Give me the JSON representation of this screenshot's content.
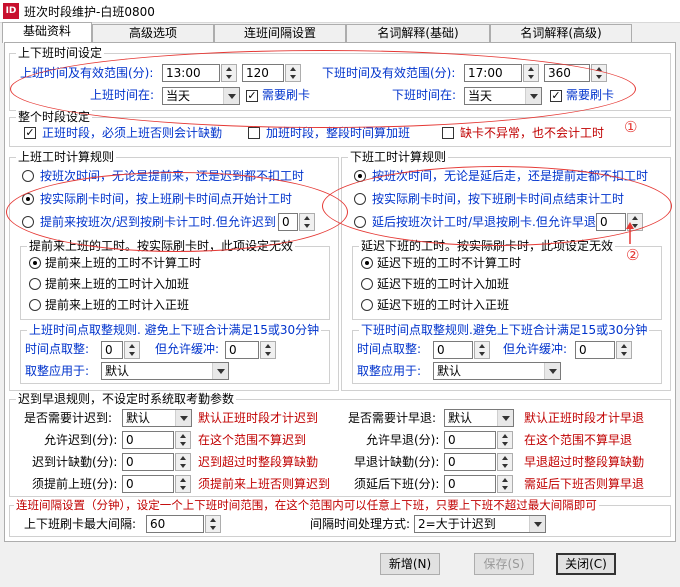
{
  "window": {
    "title": "班次时段维护-白班0800",
    "icon": "app-logo"
  },
  "tabs": [
    {
      "label": "基础资料"
    },
    {
      "label": "高级选项"
    },
    {
      "label": "连班间隔设置"
    },
    {
      "label": "名词解释(基础)"
    },
    {
      "label": "名词解释(高级)"
    }
  ],
  "shift_time": {
    "title": "上下班时间设定",
    "on_duty_label": "上班时间及有效范围(分):",
    "on_duty_time": "13:00",
    "on_duty_range": "120",
    "off_duty_label": "下班时间及有效范围(分):",
    "off_duty_time": "17:00",
    "off_duty_range": "360",
    "on_day_label": "上班时间在:",
    "on_day": "当天",
    "on_need_card": "需要刷卡",
    "off_day_label": "下班时间在:",
    "off_day": "当天",
    "off_need_card": "需要刷卡"
  },
  "whole_period": {
    "title": "整个时段设定",
    "normal": "正班时段，必须上班否则会计缺勤",
    "overtime": "加班时段，整段时间算加班",
    "no_abnormal": "缺卡不异常，也不会计工时"
  },
  "on_rules": {
    "title": "上班工时计算规则",
    "opt1": "按班次时间，无论是提前来，还是迟到都不扣工时",
    "opt2": "按实际刷卡时间，按上班刷卡时间点开始计工时",
    "opt3": "提前来按班次/迟到按刷卡计工时.但允许迟到",
    "allow_late": "0",
    "early_title": "提前来上班的工时。按实际刷卡时，此项设定无效",
    "early1": "提前来上班的工时不计算工时",
    "early2": "提前来上班的工时计入加班",
    "early3": "提前来上班的工时计入正班",
    "round_title": "上班时间点取整规则. 避免上下班合计满足15或30分钟",
    "round_label": "时间点取整:",
    "round_value": "0",
    "buffer_label": "但允许缓冲:",
    "buffer_value": "0",
    "apply_label": "取整应用于:",
    "apply_value": "默认"
  },
  "off_rules": {
    "title": "下班工时计算规则",
    "opt1": "按班次时间，无论是延后走，还是提前走都不扣工时",
    "opt2": "按实际刷卡时间，按下班刷卡时间点结束计工时",
    "opt3": "延后按班次计工时/早退按刷卡.但允许早退",
    "allow_early": "0",
    "late_title": "延迟下班的工时。按实际刷卡时，此项设定无效",
    "late1": "延迟下班的工时不计算工时",
    "late2": "延迟下班的工时计入加班",
    "late3": "延迟下班的工时计入正班",
    "round_title": "下班时间点取整规则.避免上下班合计满足15或30分钟",
    "round_label": "时间点取整:",
    "round_value": "0",
    "buffer_label": "但允许缓冲:",
    "buffer_value": "0",
    "apply_label": "取整应用于:",
    "apply_value": "默认"
  },
  "late_early": {
    "title": "迟到早退规则，不设定时系统取考勤参数",
    "need_late_label": "是否需要计迟到:",
    "need_late_value": "默认",
    "need_late_hint": "默认正班时段才计迟到",
    "allow_late_label": "允许迟到(分):",
    "allow_late_value": "0",
    "allow_late_hint": "在这个范围不算迟到",
    "late_absent_label": "迟到计缺勤(分):",
    "late_absent_value": "0",
    "late_absent_hint": "迟到超过时整段算缺勤",
    "must_early_label": "须提前上班(分):",
    "must_early_value": "0",
    "must_early_hint": "须提前来上班否则算迟到",
    "need_early_label": "是否需要计早退:",
    "need_early_value": "默认",
    "need_early_hint": "默认正班时段才计早退",
    "allow_early_label": "允许早退(分):",
    "allow_early_value": "0",
    "allow_early_hint": "在这个范围不算早退",
    "early_absent_label": "早退计缺勤(分):",
    "early_absent_value": "0",
    "early_absent_hint": "早退超过时整段算缺勤",
    "must_late_label": "须延后下班(分):",
    "must_late_value": "0",
    "must_late_hint": "需延后下班否则算早退"
  },
  "interval": {
    "title": "连班间隔设置（分钟），设定一个上下班时间范围，在这个范围内可以任意上下班，只要上下班不超过最大间隔即可",
    "max_label": "上下班刷卡最大间隔:",
    "max_value": "60",
    "method_label": "间隔时间处理方式:",
    "method_value": "2=大于计迟到"
  },
  "buttons": {
    "add": "新增(N)",
    "save": "保存(S)",
    "close": "关闭(C)"
  },
  "annotations": {
    "mark1": "①",
    "mark2": "②"
  },
  "colors": {
    "annotation": "#e53935",
    "label_blue": "#0033cc",
    "label_red": "#c00000"
  }
}
